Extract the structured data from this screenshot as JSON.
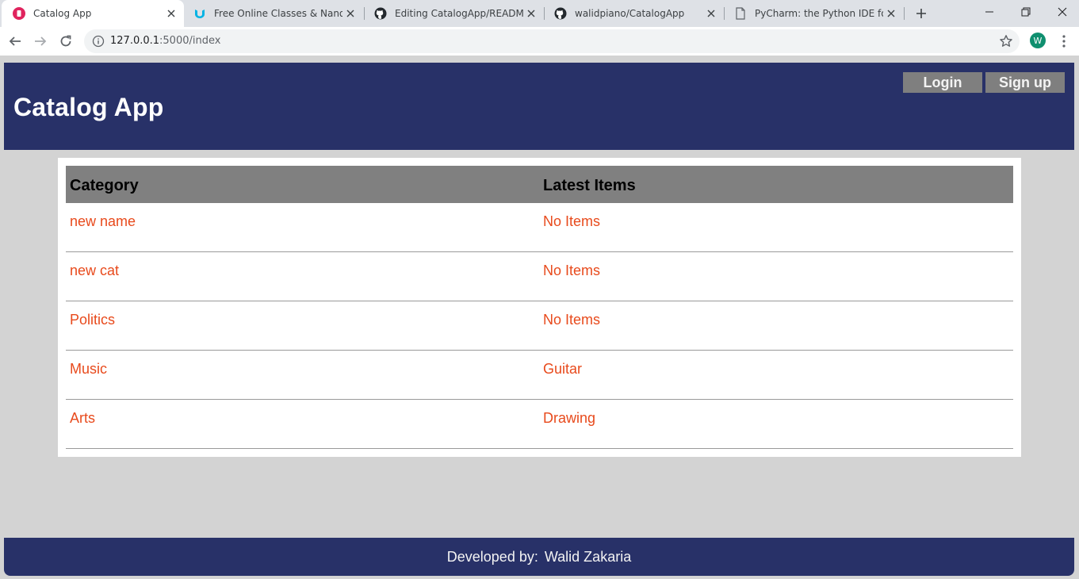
{
  "browser": {
    "tabs": [
      {
        "title": "Catalog App",
        "icon": "catalog-app-favicon",
        "active": true
      },
      {
        "title": "Free Online Classes & Nanodegrees",
        "icon": "udacity-icon",
        "active": false
      },
      {
        "title": "Editing CatalogApp/README.md",
        "icon": "github-icon",
        "active": false
      },
      {
        "title": "walidpiano/CatalogApp",
        "icon": "github-icon",
        "active": false
      },
      {
        "title": "PyCharm: the Python IDE for Professional Developers",
        "icon": "page-icon",
        "active": false
      }
    ],
    "url_host": "127.0.0.1",
    "url_rest": ":5000/index",
    "profile_initial": "W"
  },
  "header": {
    "title": "Catalog App",
    "login_label": "Login",
    "signup_label": "Sign up"
  },
  "table": {
    "headers": [
      "Category",
      "Latest Items"
    ],
    "rows": [
      {
        "category": "new name",
        "latest": "No Items"
      },
      {
        "category": "new cat",
        "latest": "No Items"
      },
      {
        "category": "Politics",
        "latest": "No Items"
      },
      {
        "category": "Music",
        "latest": "Guitar"
      },
      {
        "category": "Arts",
        "latest": "Drawing"
      }
    ]
  },
  "footer": {
    "label": "Developed by:",
    "author": "Walid Zakaria"
  },
  "colors": {
    "header_bg": "#283168",
    "button_bg": "#7f7f7f",
    "link": "#e84a1c",
    "page_bg": "#d3d3d3"
  }
}
